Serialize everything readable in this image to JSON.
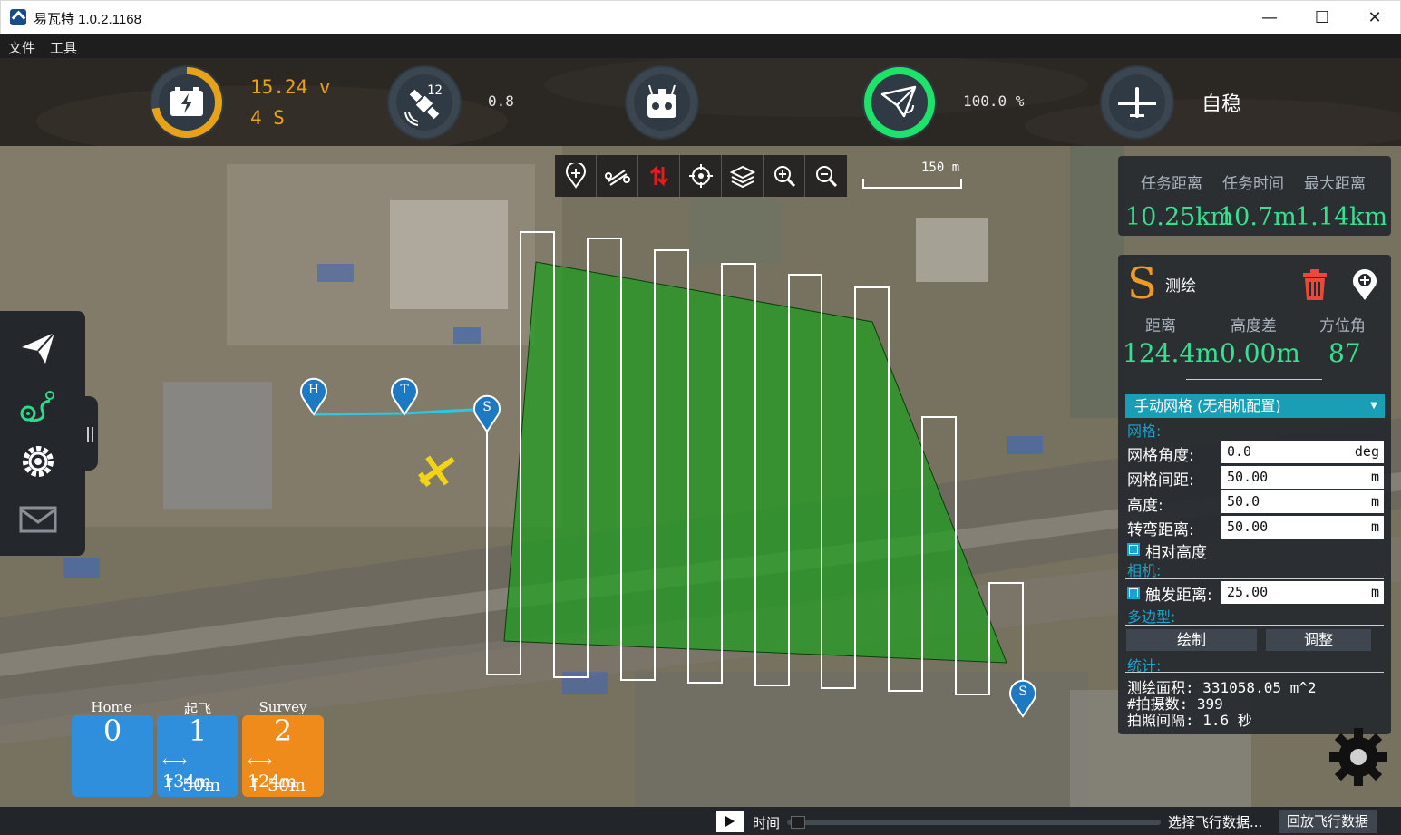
{
  "window": {
    "title": "易瓦特 1.0.2.1168",
    "minimize": "—",
    "maximize": "☐",
    "close": "✕"
  },
  "menu": [
    "文件",
    "工具"
  ],
  "status": {
    "battery_voltage": "15.24 v",
    "battery_cells": "4 S",
    "battery_level": 0.72,
    "gps_satellites": "12",
    "gps_hdop": "0.8",
    "link_quality": "100.0 %",
    "link_level": 1.0,
    "flight_mode": "自稳",
    "battery_color": "#e8a21a",
    "link_color": "#1de36b"
  },
  "map_toolbar": {
    "icons": [
      "add-waypoint-icon",
      "route-icon",
      "swap-icon",
      "locate-icon",
      "layers-icon",
      "zoom-in-icon",
      "zoom-out-icon"
    ]
  },
  "scale": "150 m",
  "mission_stats": {
    "headers": [
      "任务距离",
      "任务时间",
      "最大距离"
    ],
    "values": [
      "10.25km",
      "10.7m",
      "1.14km"
    ]
  },
  "editor": {
    "badge": "S",
    "name": "测绘",
    "headers": [
      "距离",
      "高度差",
      "方位角"
    ],
    "values": [
      "124.4m",
      "0.00m",
      "87"
    ],
    "combo": "手动网格 (无相机配置)",
    "section_grid": "网格:",
    "fields": [
      {
        "label": "网格角度:",
        "value": "0.0",
        "unit": "deg"
      },
      {
        "label": "网格间距:",
        "value": "50.00",
        "unit": "m"
      },
      {
        "label": "高度:",
        "value": "50.0",
        "unit": "m"
      },
      {
        "label": "转弯距离:",
        "value": "50.00",
        "unit": "m"
      }
    ],
    "relative_altitude": "相对高度",
    "section_camera": "相机:",
    "trigger_label": "触发距离:",
    "trigger_value": "25.00",
    "trigger_unit": "m",
    "section_polygon": "多边型:",
    "btn_draw": "绘制",
    "btn_adjust": "调整",
    "section_stats": "统计:",
    "stat_area": "测绘面积: 331058.05 m^2",
    "stat_photos": "#拍摄数:  399",
    "stat_interval": "拍照间隔: 1.6 秒"
  },
  "markers": {
    "home": "H",
    "takeoff": "T",
    "survey_start": "S",
    "survey_end": "S"
  },
  "cards": [
    {
      "title": "Home",
      "num": "0",
      "color": "#2f8fdc"
    },
    {
      "title": "起飞",
      "num": "1",
      "dist": "134m",
      "alt": "50m",
      "color": "#2f8fdc"
    },
    {
      "title": "Survey",
      "num": "2",
      "dist": "124m",
      "alt": "50m",
      "color": "#ef8b1a"
    }
  ],
  "bottom": {
    "time_label": "时间",
    "select_data": "选择飞行数据...",
    "replay": "回放飞行数据"
  }
}
